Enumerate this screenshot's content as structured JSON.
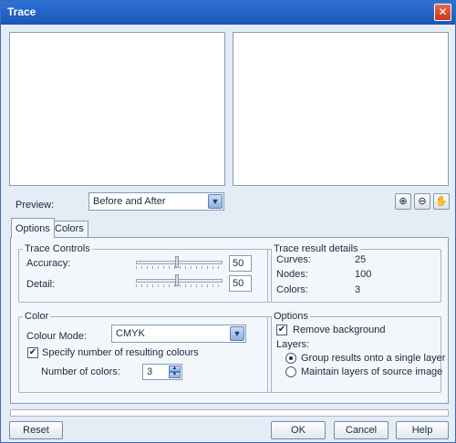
{
  "window": {
    "title": "Trace",
    "close_label": "✕"
  },
  "preview": {
    "label": "Preview:",
    "selected": "Before and After",
    "tools": {
      "zoom_in": "⊕",
      "zoom_out": "⊖",
      "pan": "✋"
    }
  },
  "tabs": [
    {
      "label": "Options",
      "active": true
    },
    {
      "label": "Colors",
      "active": false
    }
  ],
  "trace_controls": {
    "title": "Trace Controls",
    "accuracy_label": "Accuracy:",
    "accuracy_value": "50",
    "detail_label": "Detail:",
    "detail_value": "50"
  },
  "trace_result": {
    "title": "Trace result details",
    "curves_label": "Curves:",
    "curves_value": "25",
    "nodes_label": "Nodes:",
    "nodes_value": "100",
    "colors_label": "Colors:",
    "colors_value": "3"
  },
  "color": {
    "title": "Color",
    "mode_label": "Colour Mode:",
    "mode_value": "CMYK",
    "specify_label": "Specify number of resulting colours",
    "specify_checked": true,
    "number_label": "Number of colors:",
    "number_value": "3"
  },
  "options": {
    "title": "Options",
    "remove_bg_label": "Remove background",
    "remove_bg_checked": true,
    "layers_label": "Layers:",
    "group_label": "Group results onto a single layer",
    "maintain_label": "Maintain layers of source image",
    "selected_layer_option": "group"
  },
  "buttons": {
    "reset": "Reset",
    "ok": "OK",
    "cancel": "Cancel",
    "help": "Help"
  },
  "colors": {
    "titlebar": "#1a56b8",
    "window_bg": "#e4ecf6",
    "close": "#c4371c"
  }
}
